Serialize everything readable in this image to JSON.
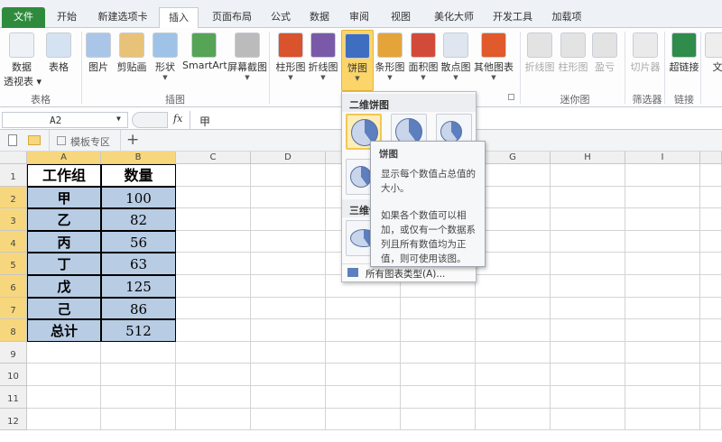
{
  "tabs": [
    "文件",
    "开始",
    "新建选项卡",
    "插入",
    "页面布局",
    "公式",
    "数据",
    "审阅",
    "视图",
    "美化大师",
    "开发工具",
    "加载项"
  ],
  "active_tab": "插入",
  "ribbon": {
    "buttons": [
      {
        "label": "数据",
        "label2": "透视表 ▾",
        "icon": "pivot-table-icon"
      },
      {
        "label": "表格",
        "icon": "table-icon"
      },
      {
        "label": "图片",
        "icon": "picture-icon"
      },
      {
        "label": "剪贴画",
        "icon": "clipart-icon"
      },
      {
        "label": "形状",
        "icon": "shapes-icon"
      },
      {
        "label": "SmartArt",
        "icon": "smartart-icon"
      },
      {
        "label": "屏幕截图",
        "icon": "screenshot-icon"
      },
      {
        "label": "柱形图",
        "icon": "column-chart-icon"
      },
      {
        "label": "折线图",
        "icon": "line-chart-icon"
      },
      {
        "label": "饼图",
        "icon": "pie-chart-icon"
      },
      {
        "label": "条形图",
        "icon": "bar-chart-icon"
      },
      {
        "label": "面积图",
        "icon": "area-chart-icon"
      },
      {
        "label": "散点图",
        "icon": "scatter-chart-icon"
      },
      {
        "label": "其他图表",
        "icon": "other-charts-icon"
      },
      {
        "label": "折线图",
        "icon": "sparkline-line-icon"
      },
      {
        "label": "柱形图",
        "icon": "sparkline-column-icon"
      },
      {
        "label": "盈亏",
        "icon": "sparkline-winloss-icon"
      },
      {
        "label": "切片器",
        "icon": "slicer-icon"
      },
      {
        "label": "超链接",
        "icon": "hyperlink-icon"
      },
      {
        "label": "文",
        "icon": "text-icon"
      }
    ],
    "groups": [
      "表格",
      "插图",
      "迷你图",
      "筛选器",
      "链接"
    ]
  },
  "formula_bar": {
    "name_box": "A2",
    "fx": "fx",
    "value": "甲"
  },
  "doc_tabs": {
    "template_tab": "模板专区",
    "add": "+"
  },
  "columns": [
    "A",
    "B",
    "C",
    "D",
    "E",
    "F",
    "G",
    "H",
    "I"
  ],
  "rows": [
    "1",
    "2",
    "3",
    "4",
    "5",
    "6",
    "7",
    "8",
    "9",
    "10",
    "11",
    "12"
  ],
  "table": [
    [
      "工作组",
      "数量"
    ],
    [
      "甲",
      "100"
    ],
    [
      "乙",
      "82"
    ],
    [
      "丙",
      "56"
    ],
    [
      "丁",
      "63"
    ],
    [
      "戊",
      "125"
    ],
    [
      "己",
      "86"
    ],
    [
      "总计",
      "512"
    ]
  ],
  "menu": {
    "section_2d": "二维饼图",
    "section_3d": "三维饼图",
    "all_types": "所有图表类型(A)..."
  },
  "tooltip": {
    "title": "饼图",
    "line1": "显示每个数值占总值的大小。",
    "line2": "如果各个数值可以相加，或仅有一个数据系列且所有数值均为正值，则可使用该图。"
  },
  "colors": {
    "file_tab": "#2e8b3c",
    "selection": "#b8cce4",
    "header_selected": "#f7d77d",
    "active_button": "#fbd46a"
  }
}
